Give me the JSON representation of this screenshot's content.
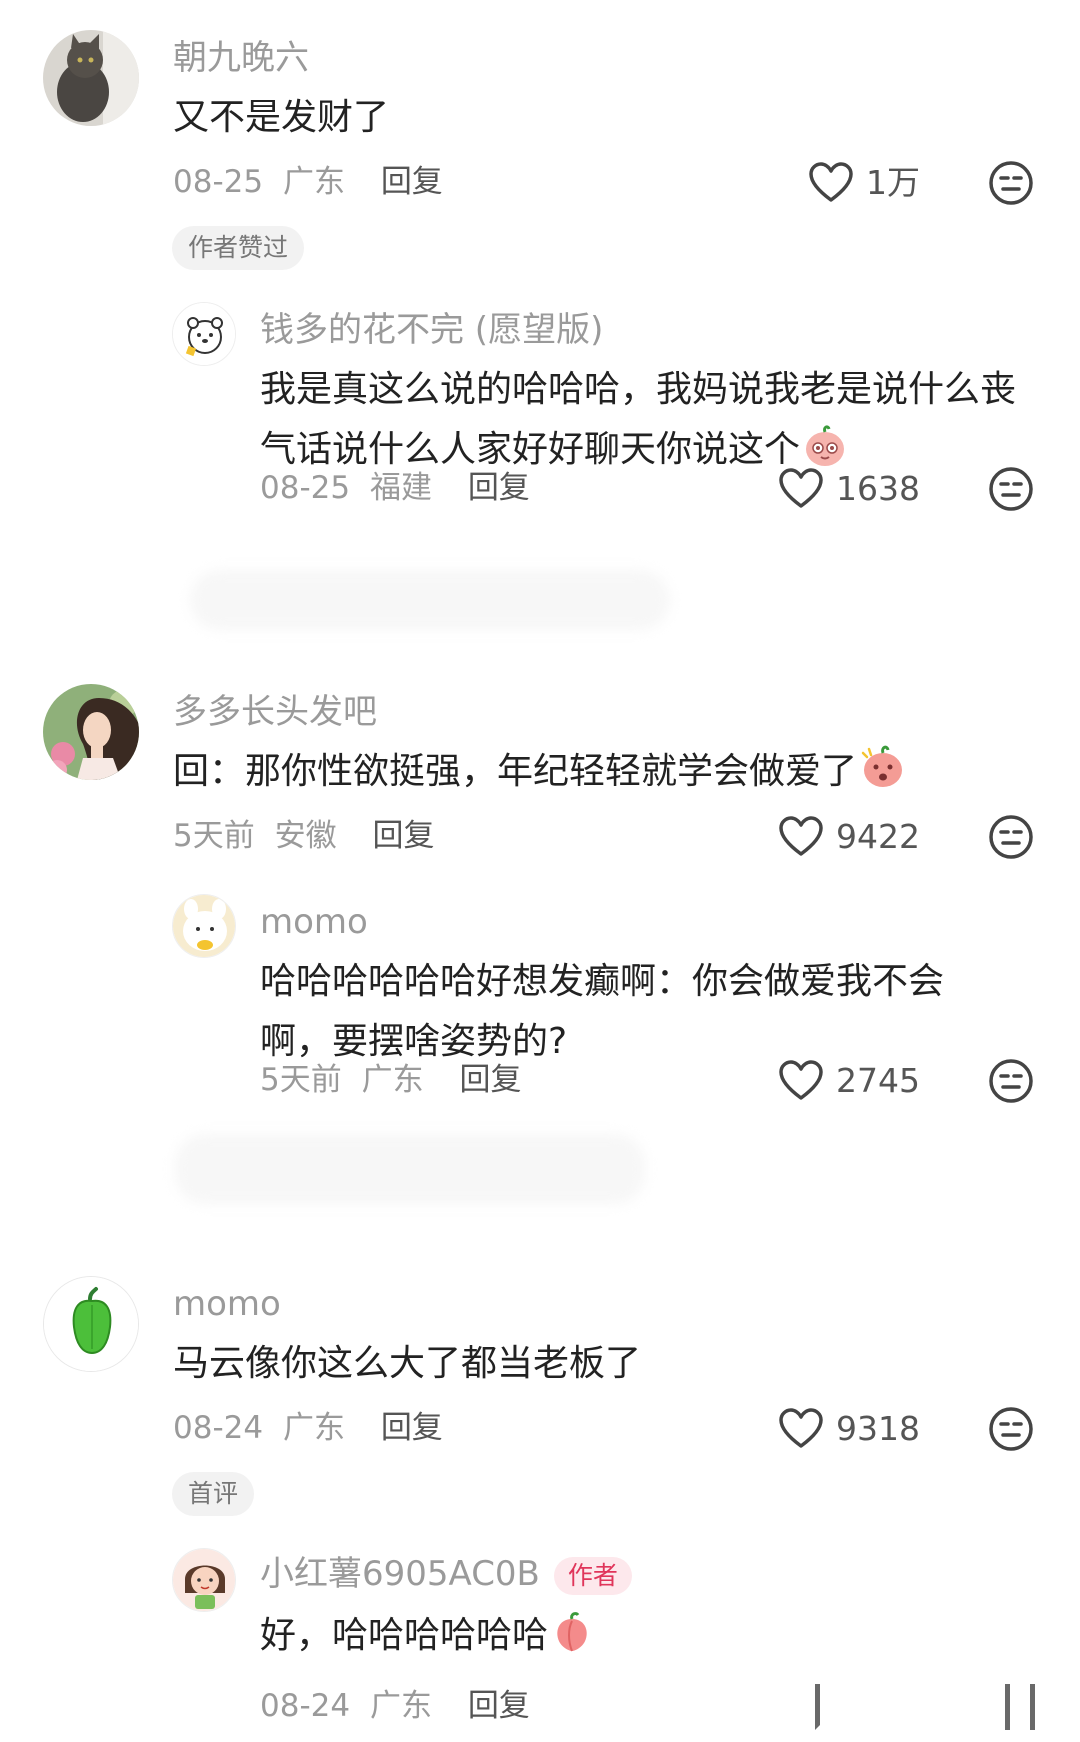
{
  "comments": [
    {
      "username": "朝九晚六",
      "text": "又不是发财了",
      "date": "08-25",
      "location": "广东",
      "reply_label": "回复",
      "likes": "1万",
      "badge": "作者赞过",
      "replies": [
        {
          "username": "钱多的花不完 (愿望版)",
          "text": "我是真这么说的哈哈哈，我妈说我老是说什么丧气话说什么人家好好聊天你说这个",
          "date": "08-25",
          "location": "福建",
          "reply_label": "回复",
          "likes": "1638"
        }
      ]
    },
    {
      "username": "多多长头发吧",
      "text": "回：那你性欲挺强，年纪轻轻就学会做爱了",
      "date": "5天前",
      "location": "安徽",
      "reply_label": "回复",
      "likes": "9422",
      "replies": [
        {
          "username": "momo",
          "text": "哈哈哈哈哈哈好想发癫啊：你会做爱我不会啊，要摆啥姿势的?",
          "date": "5天前",
          "location": "广东",
          "reply_label": "回复",
          "likes": "2745"
        }
      ]
    },
    {
      "username": "momo",
      "text": "马云像你这么大了都当老板了",
      "date": "08-24",
      "location": "广东",
      "reply_label": "回复",
      "likes": "9318",
      "badge": "首评",
      "replies": [
        {
          "username": "小红薯6905AC0B",
          "author_badge": "作者",
          "text": "好，哈哈哈哈哈哈",
          "date": "08-24",
          "location": "广东",
          "reply_label": "回复"
        }
      ]
    }
  ],
  "colors": {
    "muted_text": "#9a9a9a",
    "body_text": "#222222",
    "author_badge_bg": "#fde8ec",
    "author_badge_text": "#e0355a",
    "pepper_green": "#4cbf3a"
  },
  "icons": [
    "heart-outline-icon",
    "dislike-face-icon",
    "cat-avatar",
    "bear-avatar",
    "woman-avatar",
    "bunny-avatar",
    "pepper-avatar",
    "girl-avatar",
    "blush-emoji",
    "shy-emoji",
    "peach-emoji"
  ]
}
